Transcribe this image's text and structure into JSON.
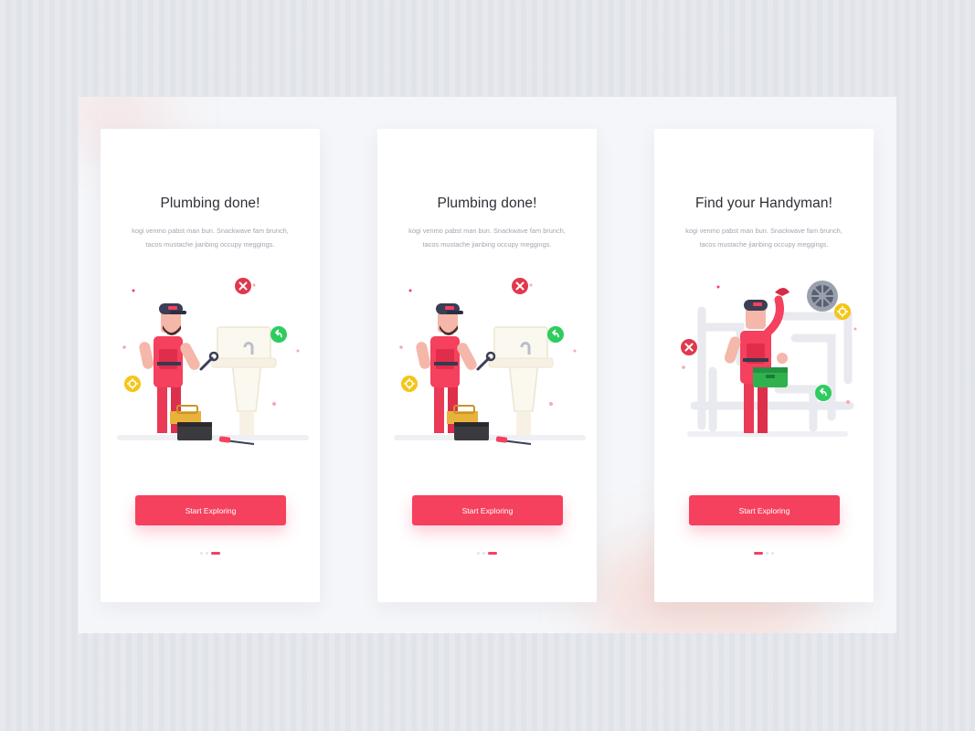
{
  "screens": [
    {
      "title": "Plumbing done!",
      "line1": "kogi venmo pabst man bun. Snackwave fam brunch,",
      "line2": "tacos mustache jianbing occupy meggings.",
      "cta": "Start Exploring",
      "illustration": "plumber-fixing-sink",
      "active_page": 3,
      "page_count": 3
    },
    {
      "title": "Plumbing done!",
      "line1": "kogi venmo pabst man bun. Snackwave fam brunch,",
      "line2": "tacos mustache jianbing occupy meggings.",
      "cta": "Start Exploring",
      "illustration": "plumber-fixing-sink",
      "active_page": 3,
      "page_count": 3
    },
    {
      "title": "Find your Handyman!",
      "line1": "kogi venmo pabst man bun. Snackwave fam brunch,",
      "line2": "tacos mustache jianbing occupy meggings.",
      "cta": "Start Exploring",
      "illustration": "handyman-with-toolbox",
      "active_page": 1,
      "page_count": 3
    }
  ],
  "colors": {
    "accent": "#f5405e",
    "title": "#2e2e36",
    "body_text": "#a2a6b2",
    "success_badge": "#2ecc5e",
    "error_badge": "#e0384e",
    "gear_badge": "#f5c518",
    "cap": "#3a3f55"
  }
}
